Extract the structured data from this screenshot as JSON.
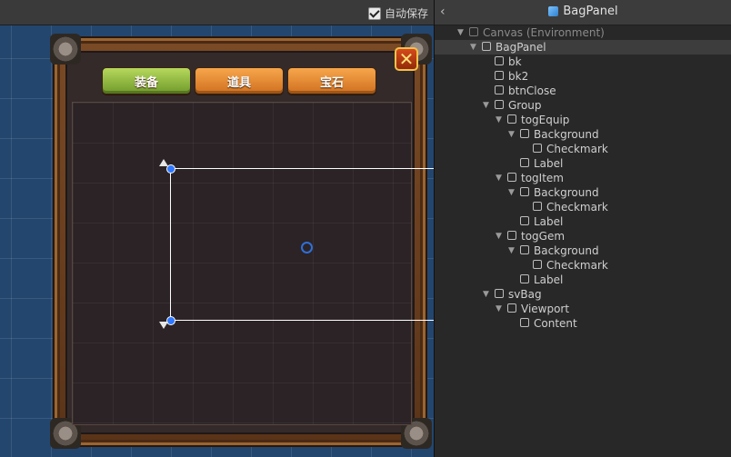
{
  "scene": {
    "autosave_label": "自动保存",
    "autosave_checked": true,
    "tabs": [
      "装备",
      "道具",
      "宝石"
    ],
    "close_symbol": "✕"
  },
  "hierarchy": {
    "header_title": "BagPanel",
    "items": [
      {
        "label": "Canvas (Environment)",
        "depth": 0,
        "expanded": true,
        "dim": true
      },
      {
        "label": "BagPanel",
        "depth": 1,
        "expanded": true,
        "selected": true
      },
      {
        "label": "bk",
        "depth": 2
      },
      {
        "label": "bk2",
        "depth": 2
      },
      {
        "label": "btnClose",
        "depth": 2
      },
      {
        "label": "Group",
        "depth": 2,
        "expanded": true
      },
      {
        "label": "togEquip",
        "depth": 3,
        "expanded": true
      },
      {
        "label": "Background",
        "depth": 4,
        "expanded": true
      },
      {
        "label": "Checkmark",
        "depth": 5
      },
      {
        "label": "Label",
        "depth": 4
      },
      {
        "label": "togItem",
        "depth": 3,
        "expanded": true
      },
      {
        "label": "Background",
        "depth": 4,
        "expanded": true
      },
      {
        "label": "Checkmark",
        "depth": 5
      },
      {
        "label": "Label",
        "depth": 4
      },
      {
        "label": "togGem",
        "depth": 3,
        "expanded": true
      },
      {
        "label": "Background",
        "depth": 4,
        "expanded": true
      },
      {
        "label": "Checkmark",
        "depth": 5
      },
      {
        "label": "Label",
        "depth": 4
      },
      {
        "label": "svBag",
        "depth": 2,
        "expanded": true
      },
      {
        "label": "Viewport",
        "depth": 3,
        "expanded": true
      },
      {
        "label": "Content",
        "depth": 4
      }
    ]
  }
}
